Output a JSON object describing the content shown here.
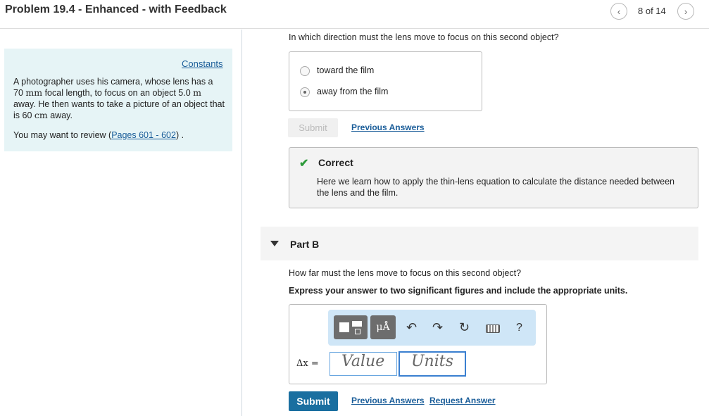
{
  "header": {
    "title": "Problem 19.4 - Enhanced - with Feedback",
    "pager_text": "8 of 14"
  },
  "left_panel": {
    "constants_link": "Constants",
    "problem_text_1": "A photographer uses his camera, whose lens has a",
    "problem_val_1": "70",
    "problem_unit_1": "mm",
    "problem_text_2": " focal length, to focus on an object 5.0 ",
    "problem_unit_2": "m",
    "problem_text_3": "away. He then wants to take a picture of an object that is 60 ",
    "problem_unit_3": "cm",
    "problem_text_4": " away.",
    "review_prefix": "You may want to review (",
    "review_link": "Pages 601 - 602",
    "review_suffix": ") ."
  },
  "part_a": {
    "question": "In which direction must the lens move to focus on this second object?",
    "choices": [
      {
        "label": "toward the film",
        "selected": false
      },
      {
        "label": "away from the film",
        "selected": true
      }
    ],
    "submit_label": "Submit",
    "previous_answers": "Previous Answers",
    "feedback": {
      "title": "Correct",
      "text": "Here we learn how to apply the thin-lens equation to calculate the distance needed between the lens and the film."
    }
  },
  "part_b": {
    "label": "Part B",
    "question": "How far must the lens move to focus on this second object?",
    "instruction": "Express your answer to two significant figures and include the appropriate units.",
    "toolbar_unit_symbol": "μÅ",
    "help": "?",
    "variable_label": "Δx =",
    "value_placeholder": "Value",
    "units_placeholder": "Units",
    "submit_label": "Submit",
    "previous_answers": "Previous Answers",
    "request_answer": "Request Answer"
  },
  "icons": {
    "prev": "chevron-left-icon",
    "next": "chevron-right-icon",
    "check": "checkmark-icon",
    "undo": "undo-icon",
    "redo": "redo-icon",
    "reset": "reset-icon",
    "keyboard": "keyboard-icon"
  },
  "colors": {
    "link": "#1a5d99",
    "correct_check": "#2d9a3a",
    "submit_bg": "#1a6fa0",
    "left_panel_bg": "#e6f4f6",
    "toolbar_bg": "#cfe6f7"
  }
}
